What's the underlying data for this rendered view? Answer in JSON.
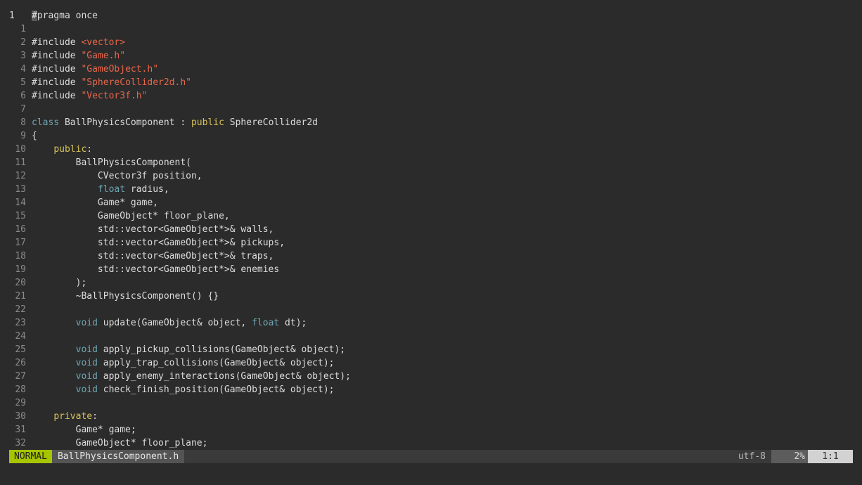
{
  "editor": {
    "current_line_number": "1",
    "lines": [
      {
        "num": "1",
        "current": true,
        "segments": [
          [
            "cursor",
            "#"
          ],
          [
            "plain",
            "pragma once"
          ]
        ]
      },
      {
        "num": "1",
        "segments": []
      },
      {
        "num": "2",
        "segments": [
          [
            "plain",
            "#include "
          ],
          [
            "str",
            "<vector>"
          ]
        ]
      },
      {
        "num": "3",
        "segments": [
          [
            "plain",
            "#include "
          ],
          [
            "str",
            "\"Game.h\""
          ]
        ]
      },
      {
        "num": "4",
        "segments": [
          [
            "plain",
            "#include "
          ],
          [
            "str",
            "\"GameObject.h\""
          ]
        ]
      },
      {
        "num": "5",
        "segments": [
          [
            "plain",
            "#include "
          ],
          [
            "str",
            "\"SphereCollider2d.h\""
          ]
        ]
      },
      {
        "num": "6",
        "segments": [
          [
            "plain",
            "#include "
          ],
          [
            "str",
            "\"Vector3f.h\""
          ]
        ]
      },
      {
        "num": "7",
        "segments": []
      },
      {
        "num": "8",
        "segments": [
          [
            "type",
            "class"
          ],
          [
            "plain",
            " BallPhysicsComponent : "
          ],
          [
            "kw",
            "public"
          ],
          [
            "plain",
            " SphereCollider2d"
          ]
        ]
      },
      {
        "num": "9",
        "segments": [
          [
            "plain",
            "{"
          ]
        ]
      },
      {
        "num": "10",
        "segments": [
          [
            "plain",
            "    "
          ],
          [
            "kw",
            "public"
          ],
          [
            "plain",
            ":"
          ]
        ]
      },
      {
        "num": "11",
        "segments": [
          [
            "plain",
            "        BallPhysicsComponent("
          ]
        ]
      },
      {
        "num": "12",
        "segments": [
          [
            "plain",
            "            CVector3f position,"
          ]
        ]
      },
      {
        "num": "13",
        "segments": [
          [
            "plain",
            "            "
          ],
          [
            "type",
            "float"
          ],
          [
            "plain",
            " radius,"
          ]
        ]
      },
      {
        "num": "14",
        "segments": [
          [
            "plain",
            "            Game* game,"
          ]
        ]
      },
      {
        "num": "15",
        "segments": [
          [
            "plain",
            "            GameObject* floor_plane,"
          ]
        ]
      },
      {
        "num": "16",
        "segments": [
          [
            "plain",
            "            std::vector<GameObject*>& walls,"
          ]
        ]
      },
      {
        "num": "17",
        "segments": [
          [
            "plain",
            "            std::vector<GameObject*>& pickups,"
          ]
        ]
      },
      {
        "num": "18",
        "segments": [
          [
            "plain",
            "            std::vector<GameObject*>& traps,"
          ]
        ]
      },
      {
        "num": "19",
        "segments": [
          [
            "plain",
            "            std::vector<GameObject*>& enemies"
          ]
        ]
      },
      {
        "num": "20",
        "segments": [
          [
            "plain",
            "        );"
          ]
        ]
      },
      {
        "num": "21",
        "segments": [
          [
            "plain",
            "        ~BallPhysicsComponent() {}"
          ]
        ]
      },
      {
        "num": "22",
        "segments": []
      },
      {
        "num": "23",
        "segments": [
          [
            "plain",
            "        "
          ],
          [
            "type",
            "void"
          ],
          [
            "plain",
            " update(GameObject& object, "
          ],
          [
            "type",
            "float"
          ],
          [
            "plain",
            " dt);"
          ]
        ]
      },
      {
        "num": "24",
        "segments": []
      },
      {
        "num": "25",
        "segments": [
          [
            "plain",
            "        "
          ],
          [
            "type",
            "void"
          ],
          [
            "plain",
            " apply_pickup_collisions(GameObject& object);"
          ]
        ]
      },
      {
        "num": "26",
        "segments": [
          [
            "plain",
            "        "
          ],
          [
            "type",
            "void"
          ],
          [
            "plain",
            " apply_trap_collisions(GameObject& object);"
          ]
        ]
      },
      {
        "num": "27",
        "segments": [
          [
            "plain",
            "        "
          ],
          [
            "type",
            "void"
          ],
          [
            "plain",
            " apply_enemy_interactions(GameObject& object);"
          ]
        ]
      },
      {
        "num": "28",
        "segments": [
          [
            "plain",
            "        "
          ],
          [
            "type",
            "void"
          ],
          [
            "plain",
            " check_finish_position(GameObject& object);"
          ]
        ]
      },
      {
        "num": "29",
        "segments": []
      },
      {
        "num": "30",
        "segments": [
          [
            "plain",
            "    "
          ],
          [
            "kw",
            "private"
          ],
          [
            "plain",
            ":"
          ]
        ]
      },
      {
        "num": "31",
        "segments": [
          [
            "plain",
            "        Game* game;"
          ]
        ]
      },
      {
        "num": "32",
        "segments": [
          [
            "plain",
            "        GameObject* floor_plane;"
          ]
        ]
      }
    ]
  },
  "statusline": {
    "mode": "NORMAL",
    "filename": "BallPhysicsComponent.h",
    "encoding": "utf-8",
    "percent": "2%",
    "position": "1:1"
  },
  "colors": {
    "background": "#2b2b2b",
    "keyword": "#d6c35a",
    "type": "#6fa6b3",
    "string": "#e8664a",
    "mode_bg": "#a7c400"
  }
}
